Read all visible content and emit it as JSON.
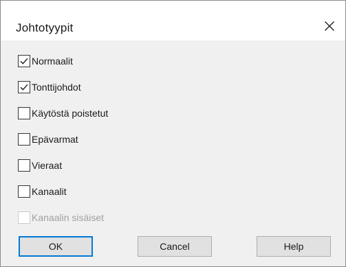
{
  "dialog": {
    "title": "Johtotyypit",
    "close_icon": "close-icon"
  },
  "checkboxes": [
    {
      "label": "Normaalit",
      "checked": true,
      "enabled": true
    },
    {
      "label": "Tonttijohdot",
      "checked": true,
      "enabled": true
    },
    {
      "label": "Käytöstä poistetut",
      "checked": false,
      "enabled": true
    },
    {
      "label": "Epävarmat",
      "checked": false,
      "enabled": true
    },
    {
      "label": "Vieraat",
      "checked": false,
      "enabled": true
    },
    {
      "label": "Kanaalit",
      "checked": false,
      "enabled": true
    },
    {
      "label": "Kanaalin sisäiset",
      "checked": false,
      "enabled": false
    }
  ],
  "buttons": {
    "ok": "OK",
    "cancel": "Cancel",
    "help": "Help"
  },
  "colors": {
    "accent": "#0078d7",
    "client_bg": "#f0f0f0",
    "disabled_text": "#a0a0a0"
  }
}
